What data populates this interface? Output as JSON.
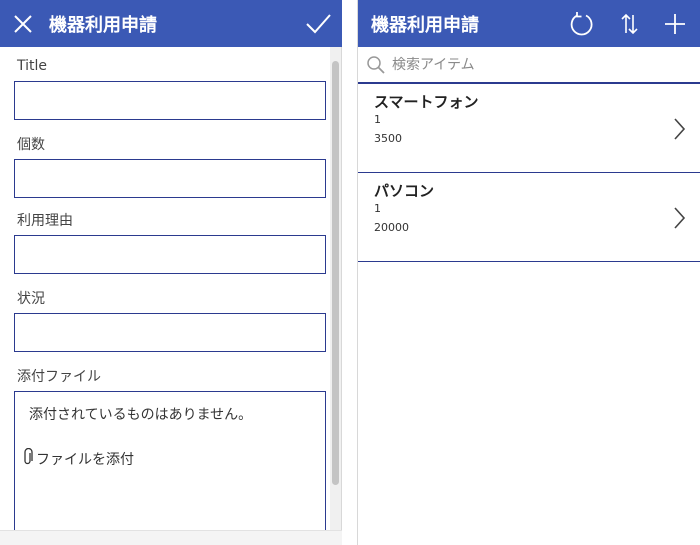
{
  "form": {
    "header": {
      "title": "機器利用申請",
      "close_icon": "close-icon",
      "submit_icon": "checkmark-icon"
    },
    "fields": [
      {
        "label": "Title",
        "value": ""
      },
      {
        "label": "個数",
        "value": ""
      },
      {
        "label": "利用理由",
        "value": ""
      },
      {
        "label": "状況",
        "value": ""
      }
    ],
    "attachments": {
      "label": "添付ファイル",
      "empty_text": "添付されているものはありません。",
      "add_label": "ファイルを添付",
      "add_icon": "paperclip-icon"
    }
  },
  "browse": {
    "header": {
      "title": "機器利用申請",
      "refresh_icon": "refresh-icon",
      "sort_icon": "sort-icon",
      "add_icon": "plus-icon"
    },
    "search": {
      "placeholder": "検索アイテム",
      "value": ""
    },
    "items": [
      {
        "title": "スマートフォン",
        "subtitle": "1",
        "body": "3500"
      },
      {
        "title": "パソコン",
        "subtitle": "1",
        "body": "20000"
      }
    ]
  },
  "colors": {
    "header": "#3b59b5",
    "border": "#2b3a8f"
  }
}
